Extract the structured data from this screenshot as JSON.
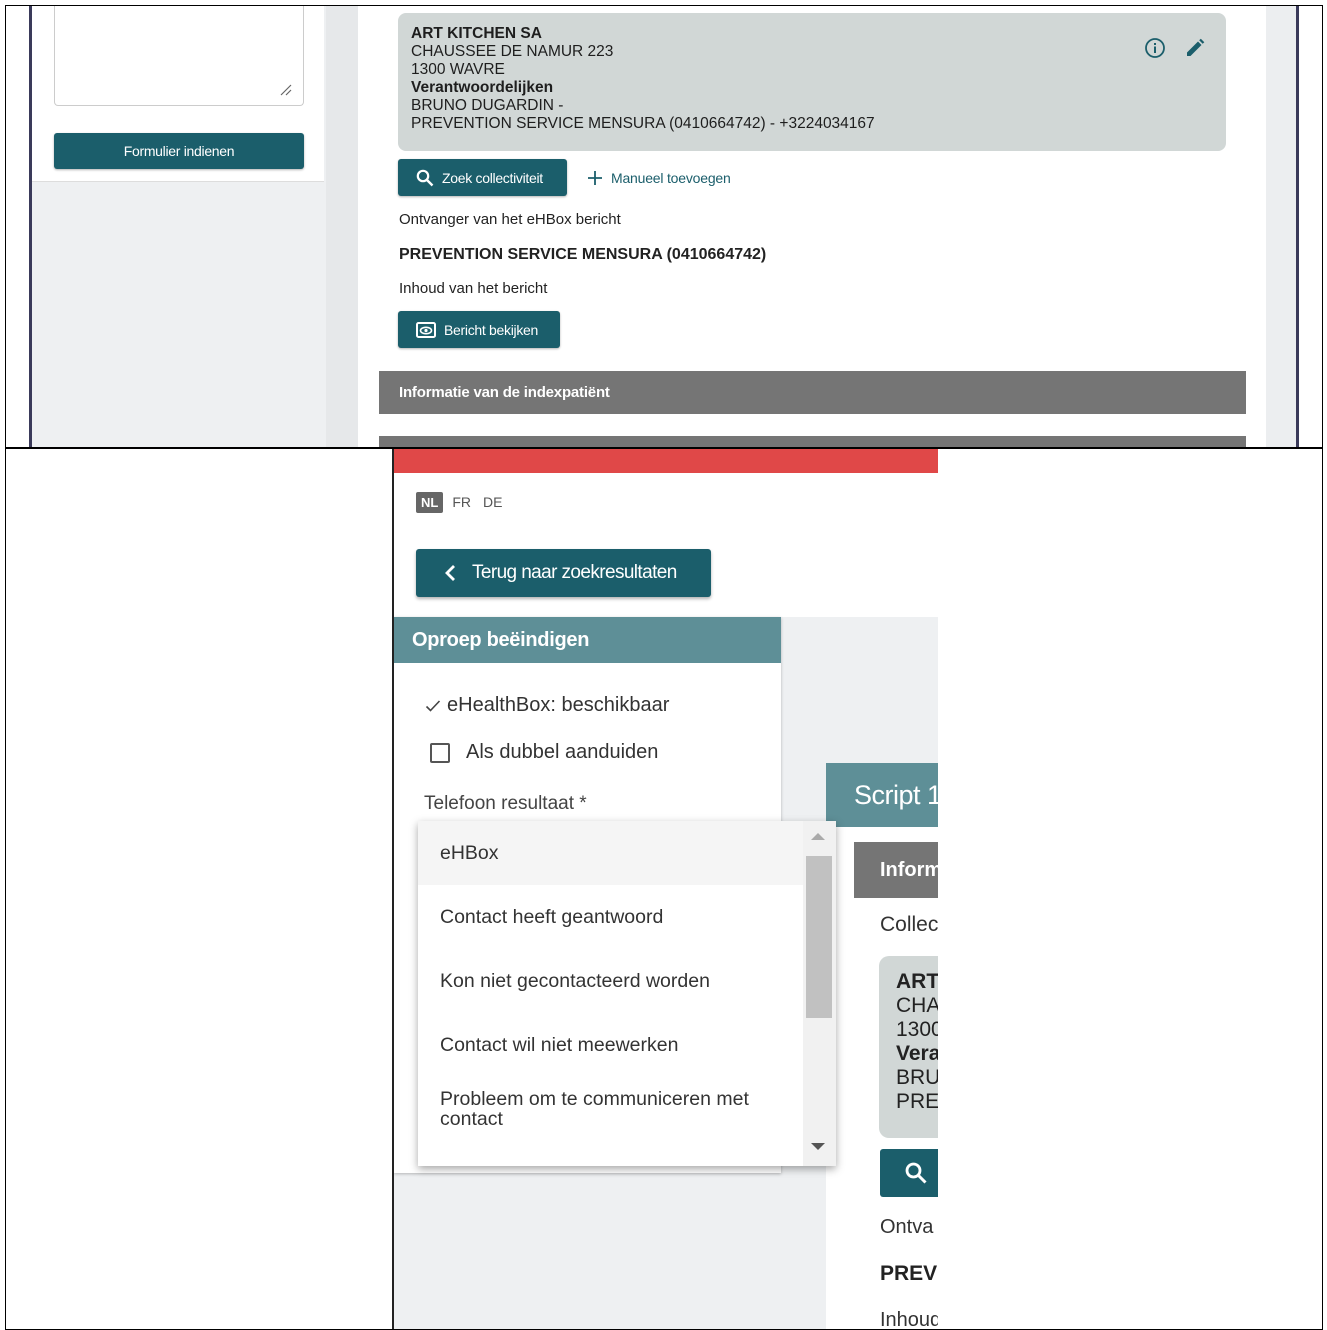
{
  "top_panel": {
    "submit_label": "Formulier indienen",
    "address": {
      "company": "ART KITCHEN SA",
      "street": "CHAUSSEE DE NAMUR 223",
      "city": "1300 WAVRE",
      "responsible_heading": "Verantwoordelijken",
      "responsible_person": "BRUNO DUGARDIN -",
      "prevention_service": "PREVENTION SERVICE MENSURA (0410664742) - +3224034167"
    },
    "search_collectivity_label": "Zoek collectiviteit",
    "manual_add_label": "Manueel toevoegen",
    "recipient_label": "Ontvanger van het eHBox bericht",
    "recipient_value": "PREVENTION SERVICE MENSURA (0410664742)",
    "content_label": "Inhoud van het bericht",
    "view_message_label": "Bericht bekijken",
    "section_index_patient": "Informatie van de indexpatiënt"
  },
  "bottom_panel": {
    "languages": [
      "NL",
      "FR",
      "DE"
    ],
    "active_language": "NL",
    "back_label": "Terug naar zoekresultaten",
    "end_call_title": "Oproep beëindigen",
    "ehealthbox_status": "eHealthBox: beschikbaar",
    "mark_double_label": "Als dubbel aanduiden",
    "phone_result_label": "Telefoon resultaat *",
    "phone_result_options": [
      "eHBox",
      "Contact heeft geantwoord",
      "Kon niet gecontacteerd worden",
      "Contact wil niet meewerken",
      "Probleem om te communiceren met contact"
    ],
    "selected_option": "eHBox",
    "script_title_partial": "Script 1",
    "info_partial": "Inform",
    "collec_partial": "Collec",
    "address_partial": [
      "ART",
      "CHA",
      "1300",
      "Vera",
      "BRU",
      "PRE"
    ],
    "ontva_partial": "Ontva",
    "prev_partial": "PREV",
    "inhoud_partial": "Inhoud"
  },
  "colors": {
    "teal_button": "#1b5e6b",
    "teal_header": "#5e8f97",
    "grey_section": "#757575",
    "address_card": "#d1d7d6",
    "red_bar": "#e04848"
  },
  "icons": {
    "info": "info-icon",
    "edit": "pencil-icon",
    "search": "search-icon",
    "plus": "plus-icon",
    "eye": "eye-icon",
    "back": "chevron-left-icon",
    "check": "check-icon"
  }
}
